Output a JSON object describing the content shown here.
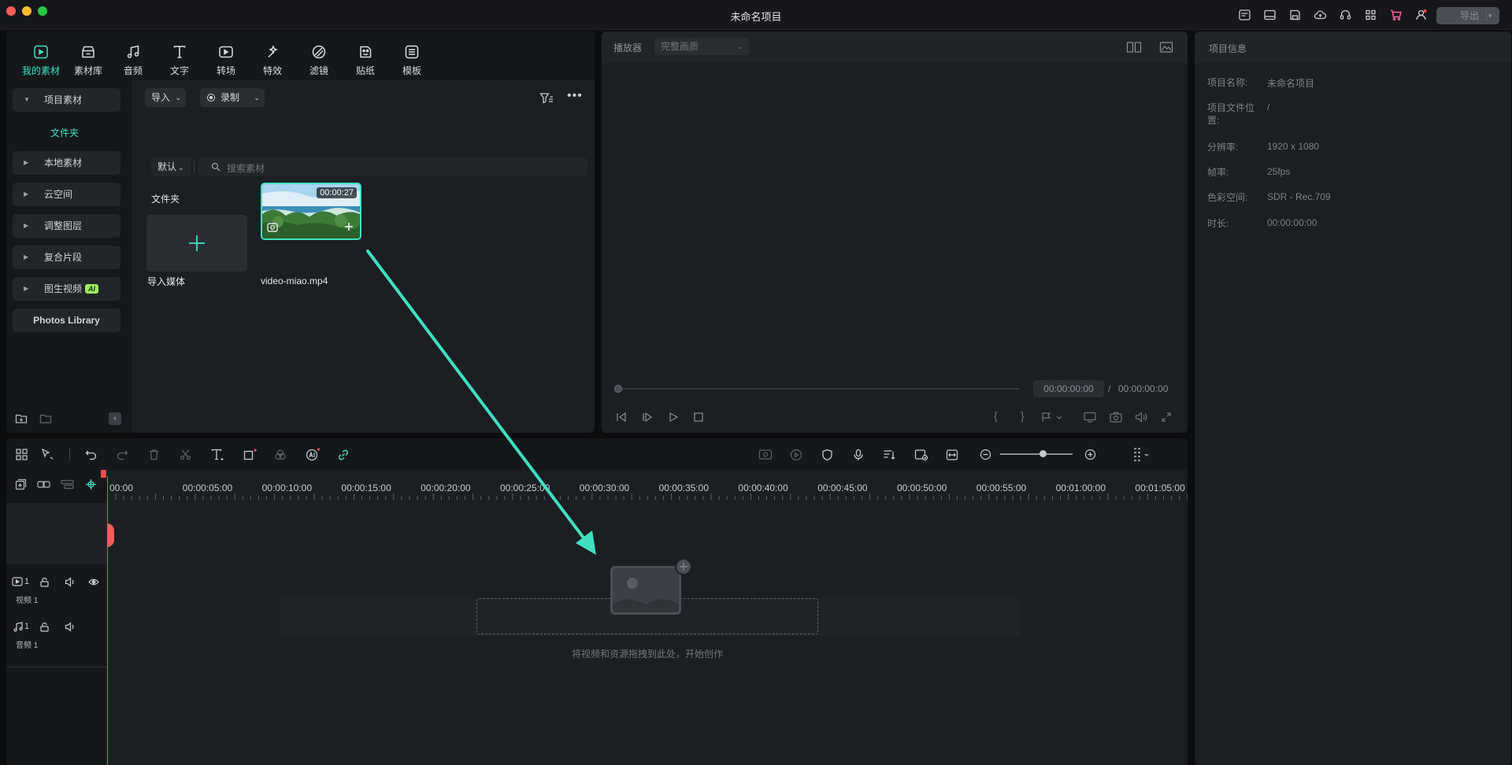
{
  "window": {
    "title": "未命名项目",
    "export_label": "导出"
  },
  "media_tabs": [
    {
      "label": "我的素材",
      "icon": "my-media-icon",
      "active": true
    },
    {
      "label": "素材库",
      "icon": "stock-media-icon"
    },
    {
      "label": "音频",
      "icon": "audio-icon"
    },
    {
      "label": "文字",
      "icon": "text-icon"
    },
    {
      "label": "转场",
      "icon": "transition-icon"
    },
    {
      "label": "特效",
      "icon": "effects-icon"
    },
    {
      "label": "滤镜",
      "icon": "filter-icon"
    },
    {
      "label": "贴纸",
      "icon": "sticker-icon"
    },
    {
      "label": "模板",
      "icon": "template-icon"
    }
  ],
  "sidebar": {
    "project_media": "项目素材",
    "folder": "文件夹",
    "items": [
      "本地素材",
      "云空间",
      "调整图层",
      "复合片段",
      "图生视频"
    ],
    "ai_badge": "AI",
    "photos_library": "Photos Library"
  },
  "media_toolbar": {
    "import_label": "导入",
    "record_label": "录制",
    "sort_label": "默认",
    "search_placeholder": "搜索素材",
    "folder_heading": "文件夹"
  },
  "media_items": [
    {
      "label": "导入媒体",
      "type": "import"
    },
    {
      "label": "video-miao.mp4",
      "duration": "00:00:27",
      "type": "video"
    }
  ],
  "preview": {
    "player_label": "播放器",
    "quality": "完整画质",
    "current_time": "00:00:00:00",
    "separator": "/",
    "total_time": "00:00:00:00",
    "progress": 0
  },
  "project_info": {
    "title": "项目信息",
    "rows": [
      {
        "label": "项目名称:",
        "value": "未命名项目"
      },
      {
        "label": "项目文件位置:",
        "value": "/"
      },
      {
        "label": "分辨率:",
        "value": "1920 x 1080"
      },
      {
        "label": "帧率:",
        "value": "25fps"
      },
      {
        "label": "色彩空间:",
        "value": "SDR - Rec.709"
      },
      {
        "label": "时长:",
        "value": "00:00:00:00"
      }
    ]
  },
  "timeline": {
    "ruler": [
      "00:00",
      "00:00:05:00",
      "00:00:10:00",
      "00:00:15:00",
      "00:00:20:00",
      "00:00:25:00",
      "00:00:30:00",
      "00:00:35:00",
      "00:00:40:00",
      "00:00:45:00",
      "00:00:50:00",
      "00:00:55:00",
      "00:01:00:00",
      "00:01:05:00"
    ],
    "tracks": [
      {
        "number": "1",
        "name": "视频 1"
      },
      {
        "number": "1",
        "name": "音频 1"
      }
    ],
    "drop_hint": "将视频和资源拖拽到此处，开始创作"
  },
  "colors": {
    "accent": "#3fe0c0",
    "playhead": "#ff4d4f",
    "background": "#1b1e22"
  }
}
